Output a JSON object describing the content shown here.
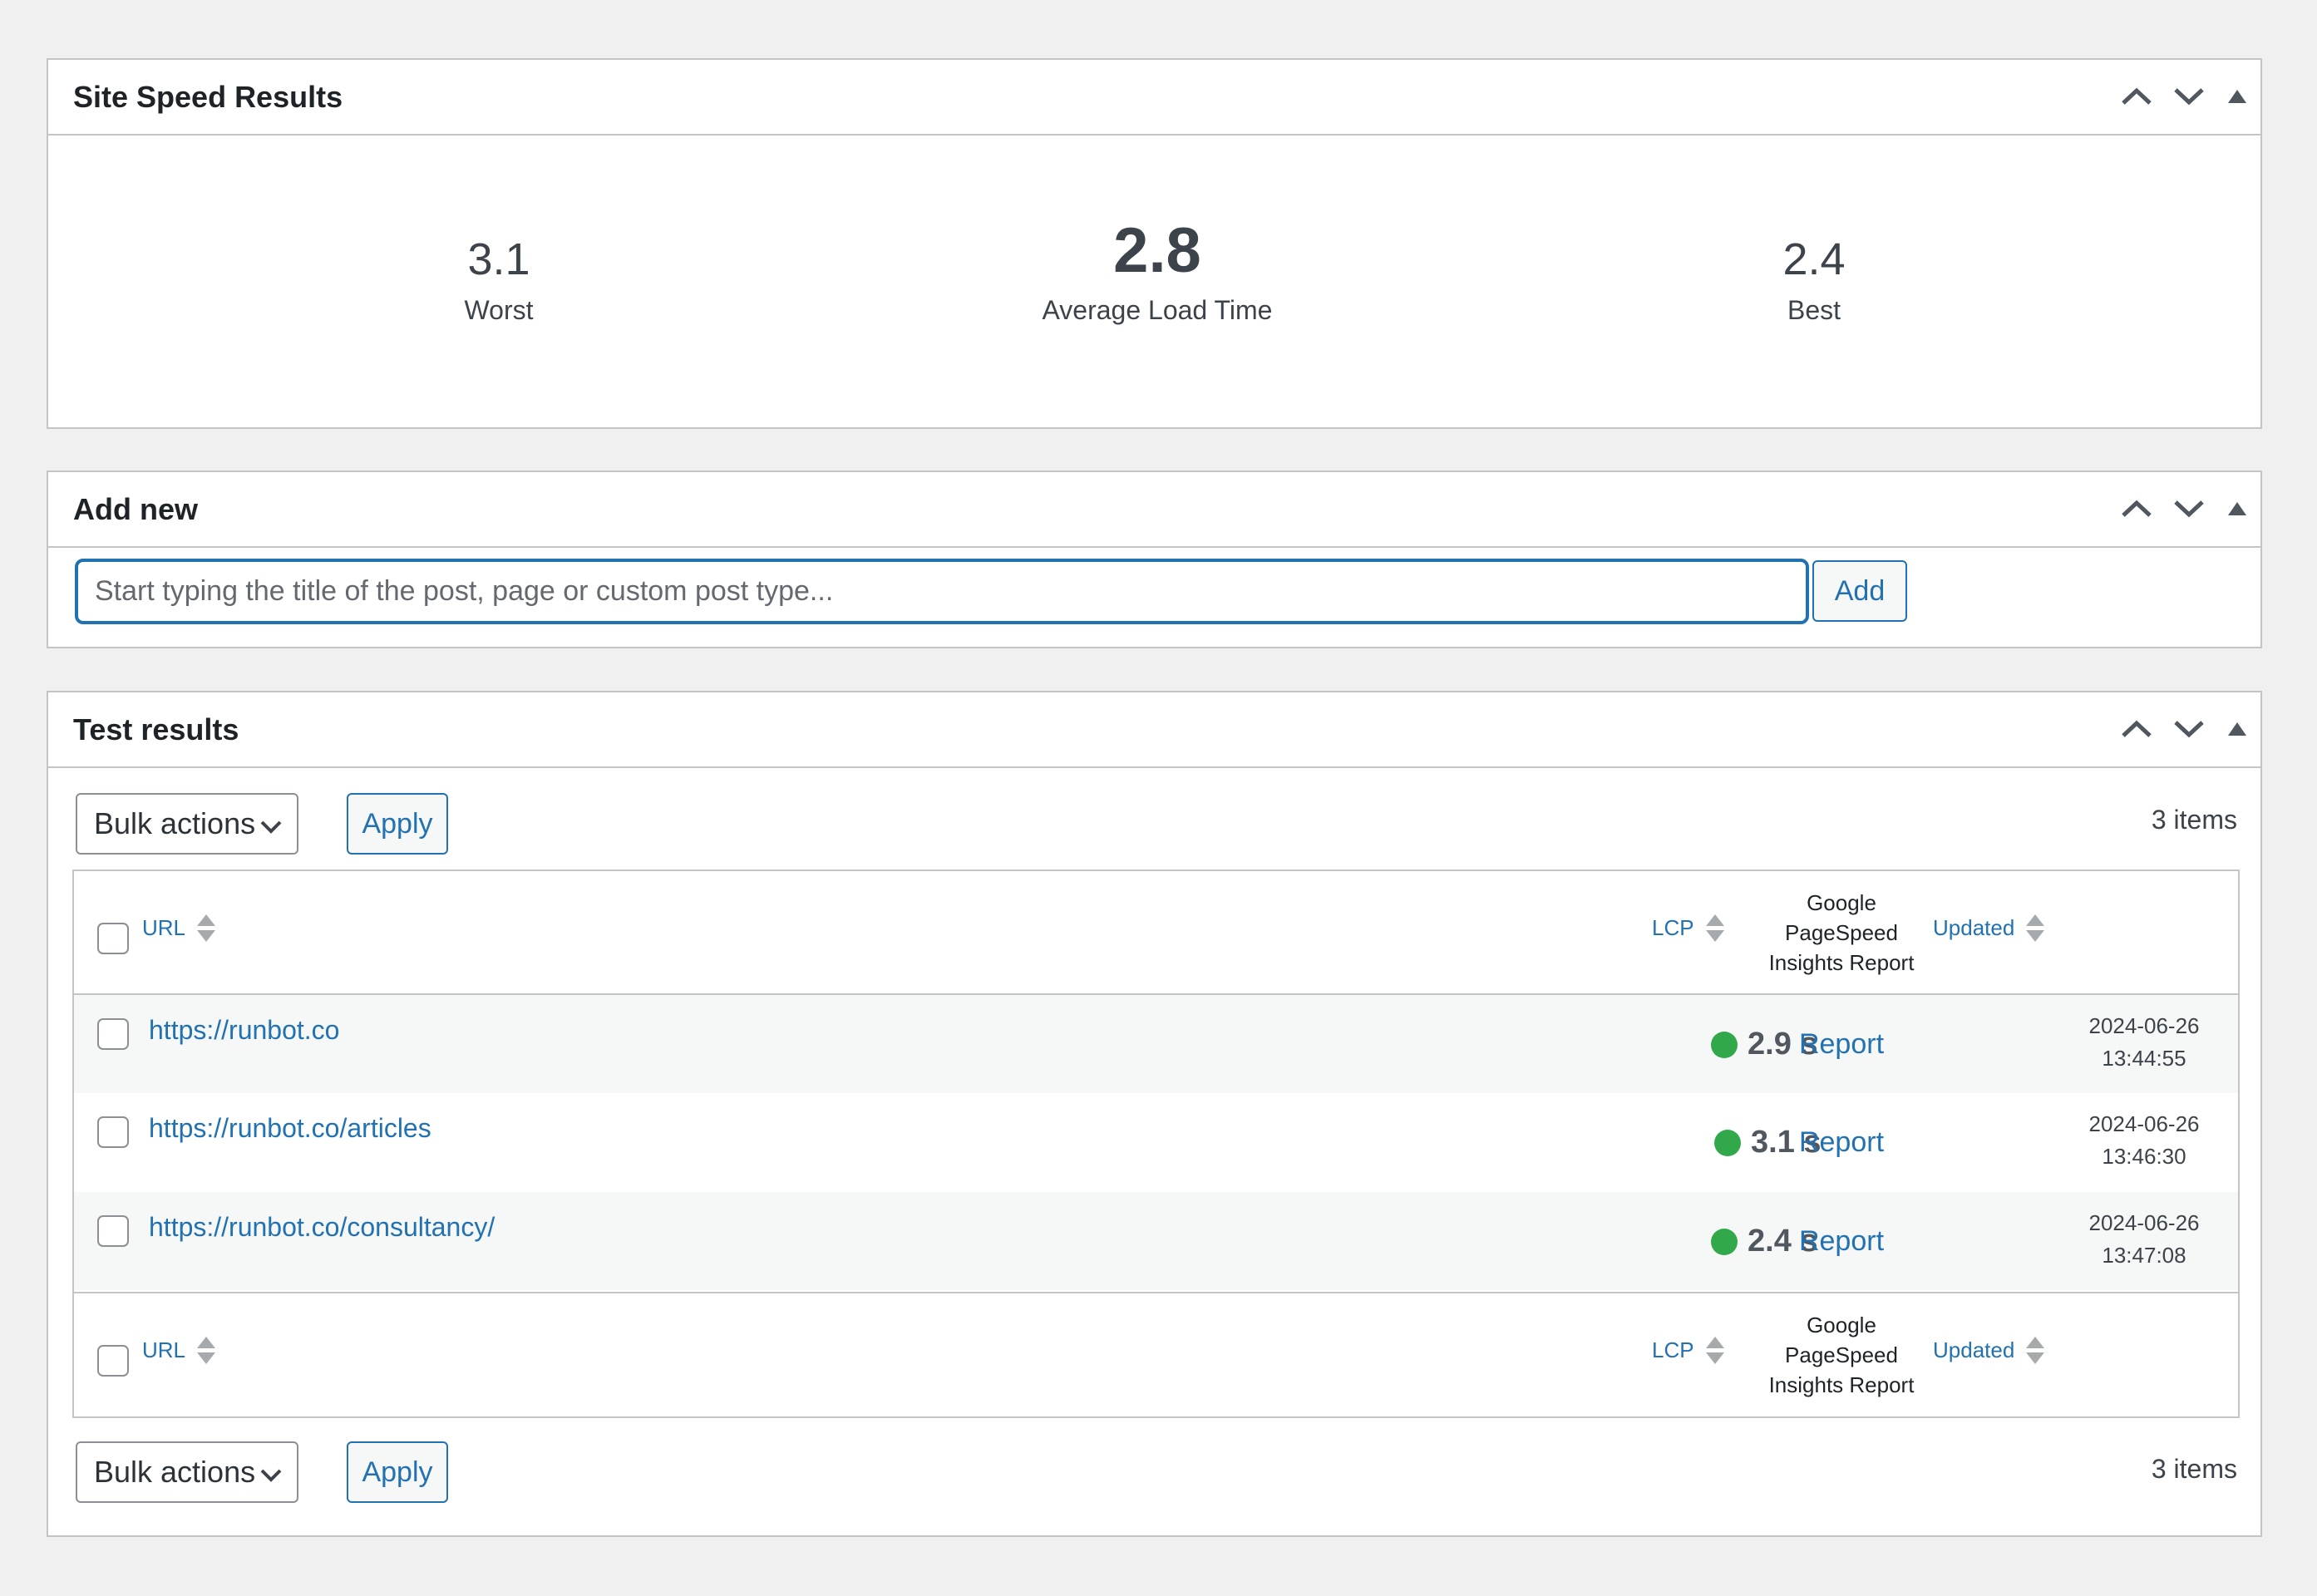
{
  "colors": {
    "accent": "#2271b1",
    "lcp_good": "#31a94b",
    "background": "#f0f0f1"
  },
  "panels": {
    "controls": {
      "move_up_icon": "chevron-up-icon",
      "move_down_icon": "chevron-down-icon",
      "toggle_icon": "triangle-up-icon"
    },
    "speed": {
      "title": "Site Speed Results",
      "worst": {
        "value": "3.1",
        "label": "Worst"
      },
      "average": {
        "value": "2.8",
        "label": "Average Load Time"
      },
      "best": {
        "value": "2.4",
        "label": "Best"
      }
    },
    "add_new": {
      "title": "Add new",
      "input_placeholder": "Start typing the title of the post, page or custom post type...",
      "input_value": "",
      "add_label": "Add"
    },
    "test_results": {
      "title": "Test results",
      "bulk_actions": {
        "selected": "Bulk actions"
      },
      "apply_label": "Apply",
      "items_count": "3 items",
      "columns": {
        "url": "URL",
        "lcp": "LCP",
        "report": [
          "Google",
          "PageSpeed",
          "Insights Report"
        ],
        "updated": "Updated"
      },
      "rows": [
        {
          "url": "https://runbot.co",
          "lcp": "2.9 s",
          "status": "good",
          "report": "Report",
          "date": "2024-06-26",
          "time": "13:44:55"
        },
        {
          "url": "https://runbot.co/articles",
          "lcp": "3.1 s",
          "status": "good",
          "report": "Report",
          "date": "2024-06-26",
          "time": "13:46:30"
        },
        {
          "url": "https://runbot.co/consultancy/",
          "lcp": "2.4 s",
          "status": "good",
          "report": "Report",
          "date": "2024-06-26",
          "time": "13:47:08"
        }
      ]
    }
  }
}
